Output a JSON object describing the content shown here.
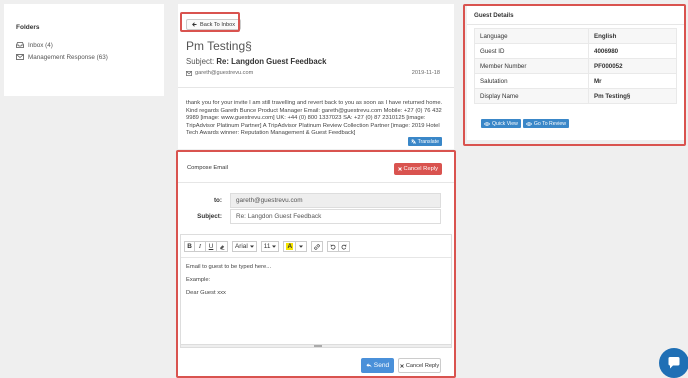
{
  "folders": {
    "title": "Folders",
    "items": [
      {
        "label": "Inbox (4)",
        "icon": "inbox-icon"
      },
      {
        "label": "Management Response (63)",
        "icon": "envelope-icon"
      }
    ]
  },
  "message": {
    "back_label": "Back To Inbox",
    "from_name": "Pm Testing§",
    "subject_prefix": "Subject:",
    "subject": "Re: Langdon Guest Feedback",
    "email": "gareth@guestrevu.com",
    "date": "2019-11-18",
    "body": "thank you for your invite I am still travelling and revert back to you as soon as I have returned home. Kind regards Gareth Bunce Product Manager Email: gareth@guestrevu.com Mobile: +27 (0) 76 432 9989 [image: www.guestrevu.com] UK: +44 (0) 800 1337023 SA: +27 (0) 87 2310125 [image: TripAdvisor Platinum Partner] A TripAdvisor Platinum Review Collection Partner [image: 2019 Hotel Tech Awards winner: Reputation Management & Guest Feedback]",
    "translate_label": "Translate"
  },
  "compose": {
    "title": "Compose Email",
    "cancel_top_label": "Cancel Reply",
    "to_label": "to:",
    "to_value": "gareth@guestrevu.com",
    "subject_label": "Subject:",
    "subject_value": "Re: Langdon Guest Feedback",
    "toolbar": {
      "bold": "B",
      "italic": "I",
      "underline": "U",
      "font": "Arial",
      "size": "11",
      "color_letter": "A"
    },
    "body_lines": [
      "Email to guest to be typed here...",
      "Example:",
      "Dear Guest xxx"
    ],
    "send_label": "Send",
    "cancel_bottom_label": "Cancel Reply"
  },
  "guest": {
    "title": "Guest Details",
    "rows": [
      {
        "label": "Language",
        "value": "English"
      },
      {
        "label": "Guest ID",
        "value": "4006980"
      },
      {
        "label": "Member Number",
        "value": "PF000052"
      },
      {
        "label": "Salutation",
        "value": "Mr"
      },
      {
        "label": "Display Name",
        "value": "Pm Testing§"
      }
    ],
    "quick_view_label": "Quick View",
    "go_to_review_label": "Go To Review"
  },
  "colors": {
    "highlight": "#d9534f",
    "primary": "#3a87c8",
    "send": "#4a90d9",
    "chat": "#1f6fb5"
  }
}
